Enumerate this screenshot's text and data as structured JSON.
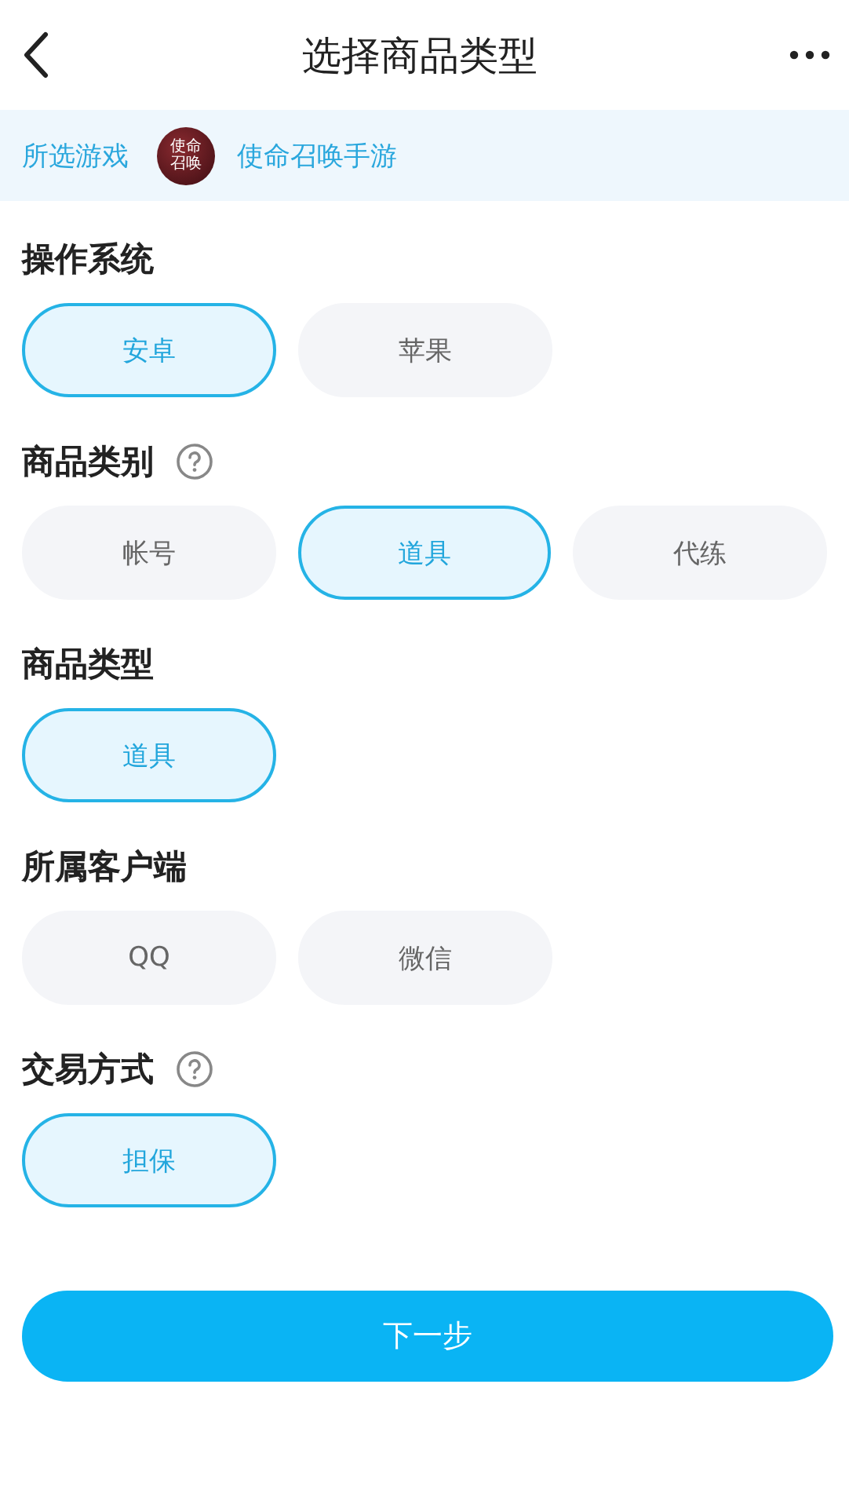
{
  "header": {
    "title": "选择商品类型"
  },
  "game": {
    "label": "所选游戏",
    "icon_text": [
      "使命",
      "召唤"
    ],
    "name": "使命召唤手游"
  },
  "sections": [
    {
      "title": "操作系统",
      "help": false,
      "options": [
        {
          "label": "安卓",
          "selected": true
        },
        {
          "label": "苹果",
          "selected": false
        }
      ]
    },
    {
      "title": "商品类别",
      "help": true,
      "options": [
        {
          "label": "帐号",
          "selected": false
        },
        {
          "label": "道具",
          "selected": true
        },
        {
          "label": "代练",
          "selected": false
        }
      ]
    },
    {
      "title": "商品类型",
      "help": false,
      "options": [
        {
          "label": "道具",
          "selected": true
        }
      ]
    },
    {
      "title": "所属客户端",
      "help": false,
      "options": [
        {
          "label": "QQ",
          "selected": false
        },
        {
          "label": "微信",
          "selected": false
        }
      ]
    },
    {
      "title": "交易方式",
      "help": true,
      "options": [
        {
          "label": "担保",
          "selected": true
        }
      ]
    }
  ],
  "next_button": "下一步"
}
